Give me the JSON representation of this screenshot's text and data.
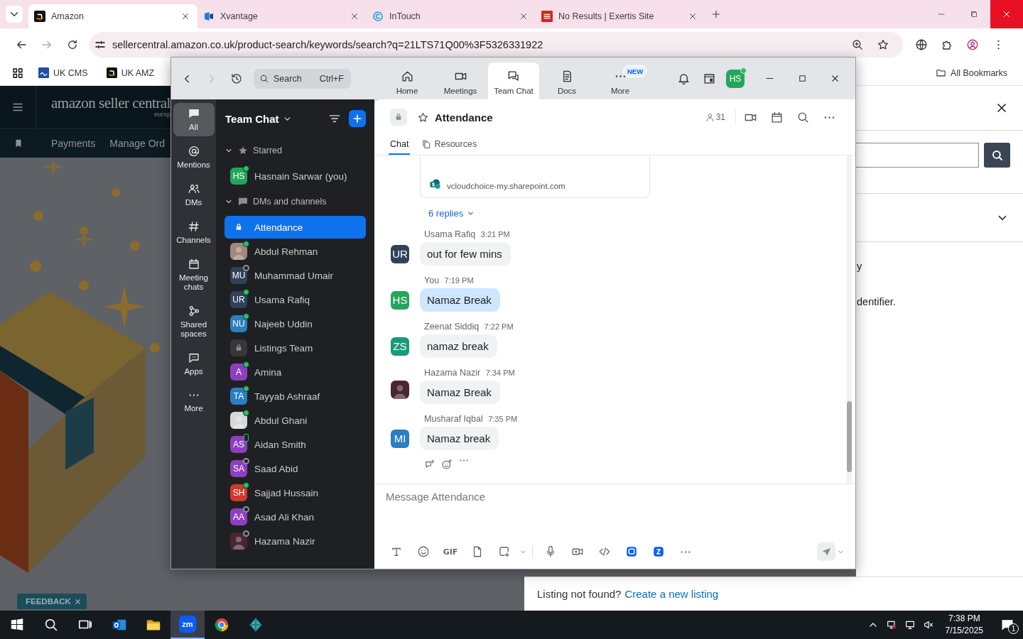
{
  "browser": {
    "tabs": [
      {
        "title": "Amazon",
        "selected": true
      },
      {
        "title": "Xvantage",
        "selected": false
      },
      {
        "title": "InTouch",
        "selected": false
      },
      {
        "title": "No Results | Exertis Site",
        "selected": false
      }
    ],
    "address": "sellercentral.amazon.co.uk/product-search/keywords/search?q=21LTS71Q00%3F5326331922",
    "bookmarks": [
      {
        "label": "UK CMS"
      },
      {
        "label": "UK AMZ"
      }
    ],
    "all_bookmarks": "All Bookmarks"
  },
  "page": {
    "logo": "amazon seller central",
    "logo_region": "europ",
    "nav": [
      "Payments",
      "Manage Ord"
    ],
    "drawer_lines": [
      "y",
      "dentifier."
    ],
    "feedback": "FEEDBACK",
    "footer": {
      "text": "Listing not found?",
      "link": "Create a new listing"
    }
  },
  "zoom": {
    "search": {
      "placeholder": "Search",
      "shortcut": "Ctrl+F"
    },
    "tabs": [
      {
        "label": "Home",
        "selected": false
      },
      {
        "label": "Meetings",
        "selected": false
      },
      {
        "label": "Team Chat",
        "selected": true
      },
      {
        "label": "Docs",
        "selected": false
      },
      {
        "label": "More",
        "badge": "NEW",
        "selected": false
      }
    ],
    "user": {
      "initials": "HS",
      "color": "#23a65b",
      "online": true
    },
    "rail": [
      {
        "label": "All",
        "selected": true
      },
      {
        "label": "Mentions",
        "selected": false
      },
      {
        "label": "DMs",
        "selected": false
      },
      {
        "label": "Channels",
        "selected": false
      },
      {
        "label": "Meeting chats",
        "selected": false
      },
      {
        "label": "Shared spaces",
        "selected": false
      },
      {
        "label": "Apps",
        "selected": false
      },
      {
        "label": "More",
        "selected": false
      }
    ],
    "list_title": "Team Chat",
    "sections": [
      {
        "title": "Starred",
        "expanded": true,
        "items": [
          {
            "name": "Hasnain Sarwar (you)",
            "kind": "initials",
            "initials": "HS",
            "color": "#23a65b",
            "online": true,
            "selected": false
          }
        ]
      },
      {
        "title": "DMs and channels",
        "expanded": true,
        "items": [
          {
            "name": "Attendance",
            "kind": "channel",
            "selected": true
          },
          {
            "name": "Abdul Rehman",
            "color": "#a2877a",
            "online": true,
            "selected": false
          },
          {
            "name": "Muhammad Umair",
            "kind": "initials",
            "initials": "MU",
            "color": "#2f4259",
            "online": false,
            "selected": false
          },
          {
            "name": "Usama Rafiq",
            "kind": "initials",
            "initials": "UR",
            "color": "#2f4259",
            "online": true,
            "selected": false
          },
          {
            "name": "Najeeb Uddin",
            "kind": "initials",
            "initials": "NU",
            "color": "#2a7fc1",
            "online": true,
            "selected": false
          },
          {
            "name": "Listings Team",
            "kind": "channel",
            "selected": false
          },
          {
            "name": "Amina",
            "kind": "initials",
            "initials": "A",
            "color": "#8e3fbf",
            "online": true,
            "selected": false
          },
          {
            "name": "Tayyab Ashraaf",
            "kind": "initials",
            "initials": "TA",
            "color": "#2a7fc1",
            "online": true,
            "selected": false
          },
          {
            "name": "Abdul Ghani",
            "color": "#d8d8d8",
            "online": true,
            "selected": false
          },
          {
            "name": "Aidan Smith",
            "kind": "initials",
            "initials": "AS",
            "color": "#8e3fbf",
            "online": true,
            "mobile": true,
            "selected": false
          },
          {
            "name": "Saad Abid",
            "kind": "initials",
            "initials": "SA",
            "color": "#8e3fbf",
            "online": false,
            "selected": false
          },
          {
            "name": "Sajjad Hussain",
            "kind": "initials",
            "initials": "SH",
            "color": "#d0392b",
            "online": true,
            "selected": false
          },
          {
            "name": "Asad Ali Khan",
            "kind": "initials",
            "initials": "AA",
            "color": "#8e3fbf",
            "online": false,
            "selected": false
          },
          {
            "name": "Hazama Nazir",
            "color": "#4a2630",
            "online": false,
            "selected": false
          }
        ]
      }
    ],
    "chat": {
      "title": "Attendance",
      "members": "31",
      "tabs": [
        {
          "label": "Chat",
          "selected": true
        },
        {
          "label": "Resources",
          "selected": false
        }
      ],
      "link_domain": "vcloudchoice-my.sharepoint.com",
      "replies": "6 replies",
      "messages": [
        {
          "sender": "Usama Rafiq",
          "time": "3:21 PM",
          "text": "out for few mins",
          "kind": "initials",
          "initials": "UR",
          "color": "#2f4259",
          "mine": false
        },
        {
          "sender": "You",
          "time": "7:19 PM",
          "text": "Namaz Break",
          "kind": "initials",
          "initials": "HS",
          "color": "#23a65b",
          "mine": true
        },
        {
          "sender": "Zeenat Siddiq",
          "time": "7:22 PM",
          "text": "namaz break",
          "kind": "initials",
          "initials": "ZS",
          "color": "#1a9a7a",
          "mine": false
        },
        {
          "sender": "Hazama Nazir",
          "time": "7:34 PM",
          "text": "Namaz Break",
          "color": "#4a2630",
          "mine": false
        },
        {
          "sender": "Musharaf Iqbal",
          "time": "7:35 PM",
          "text": "Namaz break",
          "kind": "initials",
          "initials": "MI",
          "color": "#2a7fc1",
          "mine": false
        }
      ],
      "composer": {
        "placeholder": "Message Attendance",
        "gif": "GIF"
      }
    }
  },
  "taskbar": {
    "apps": [
      {
        "selected": false
      },
      {
        "selected": false
      },
      {
        "label": "zm",
        "selected": true
      },
      {
        "selected": false
      },
      {
        "selected": false
      }
    ],
    "time": "7:38 PM",
    "date": "7/15/2025",
    "notifications": "1"
  }
}
